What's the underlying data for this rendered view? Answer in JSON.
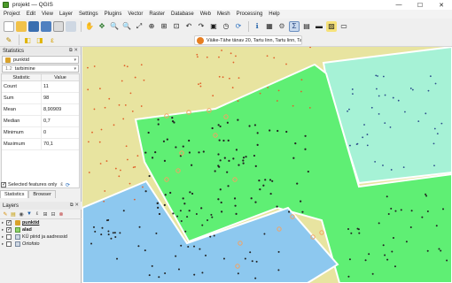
{
  "window": {
    "title": "projekt — QGIS"
  },
  "menu": [
    "Project",
    "Edit",
    "View",
    "Layer",
    "Settings",
    "Plugins",
    "Vector",
    "Raster",
    "Database",
    "Web",
    "Mesh",
    "Processing",
    "Help"
  ],
  "locator": {
    "text": "Väike-Tähe tänav 20, Tartu linn, Tartu linn, Ta"
  },
  "statistics_panel": {
    "title": "Statistics",
    "layer": "punktid",
    "field": "tarbimine",
    "field_prefix": "1.2",
    "columns": [
      "Statistic",
      "Value"
    ],
    "rows": [
      {
        "stat": "Count",
        "value": "11"
      },
      {
        "stat": "Sum",
        "value": "98"
      },
      {
        "stat": "Mean",
        "value": "8,90909"
      },
      {
        "stat": "Median",
        "value": "0,7"
      },
      {
        "stat": "Minimum",
        "value": "0"
      },
      {
        "stat": "Maximum",
        "value": "70,1"
      }
    ],
    "selected_only_label": "Selected features only",
    "tabs": [
      "Statistics",
      "Browser"
    ]
  },
  "layers_panel": {
    "title": "Layers",
    "items": [
      {
        "name": "punktid",
        "checked": true,
        "bold": true
      },
      {
        "name": "alad",
        "checked": true,
        "bold": true
      },
      {
        "name": "KÜ piirid ja aadressid",
        "checked": false,
        "bold": false
      },
      {
        "name": "Ortofoto",
        "checked": false,
        "bold": false
      }
    ]
  },
  "colors": {
    "background_area": "#e8e4a0",
    "green_area": "#5fef74",
    "light_green_area": "#a6f2d6",
    "blue_area": "#8dc8ef",
    "selected_point": "#f4a261",
    "point": "#222222"
  }
}
